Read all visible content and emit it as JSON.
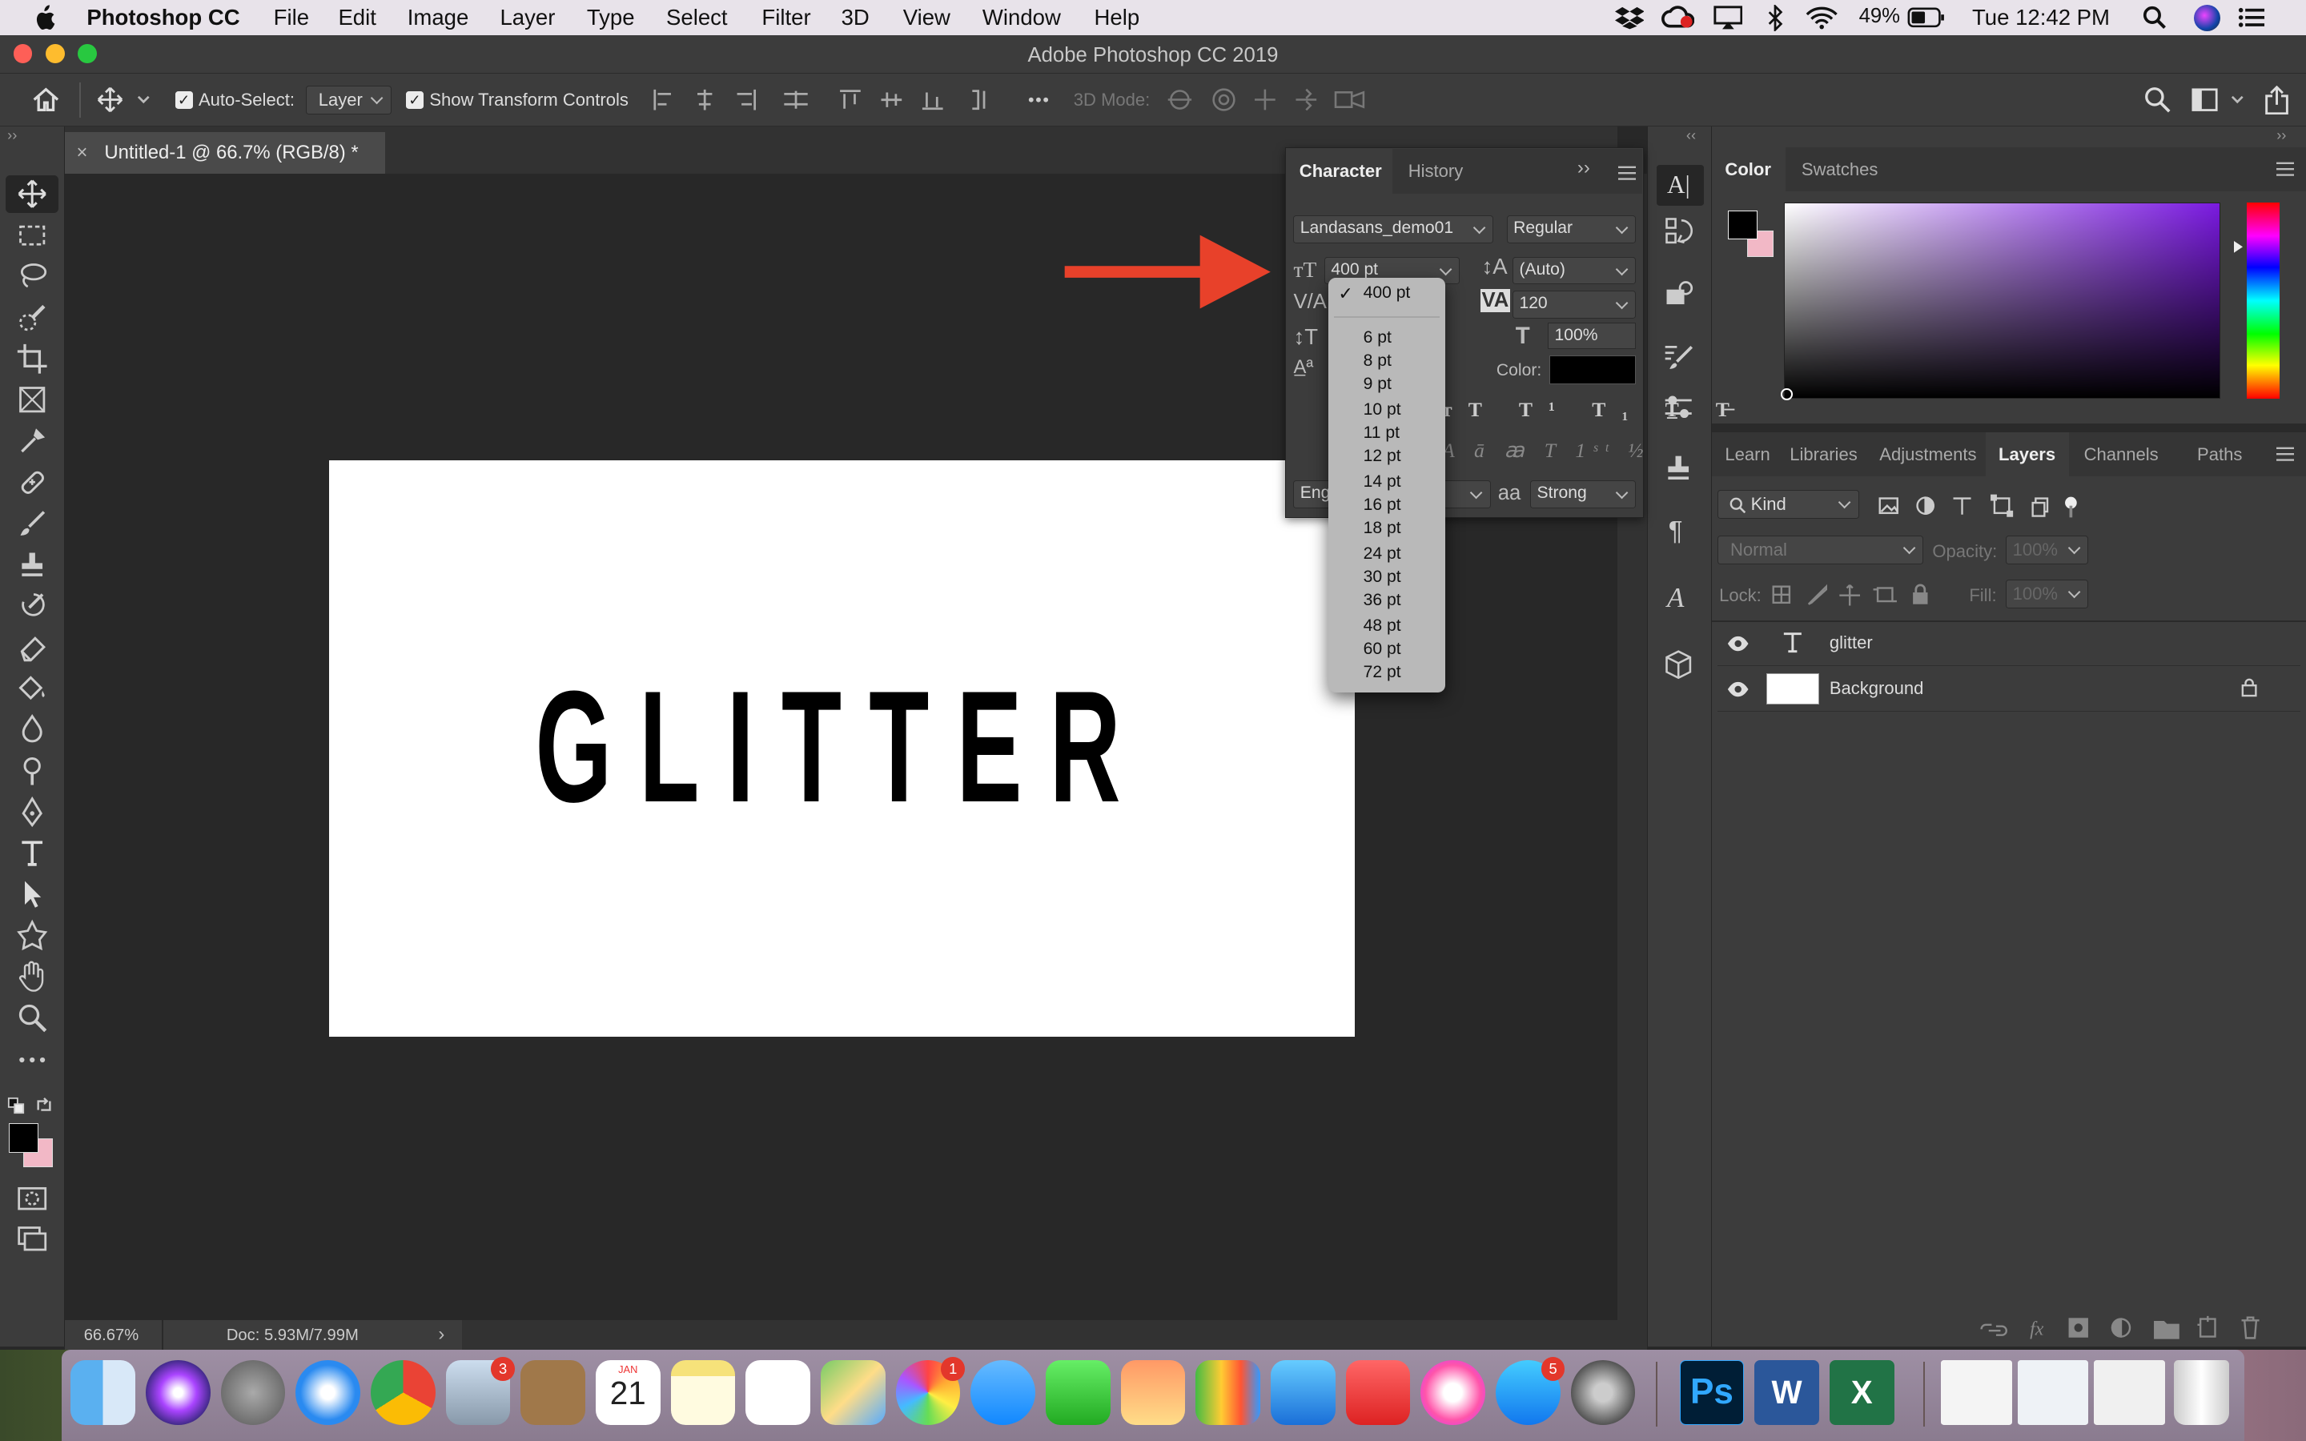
{
  "menubar": {
    "app": "Photoshop CC",
    "items": [
      "File",
      "Edit",
      "Image",
      "Layer",
      "Type",
      "Select",
      "Filter",
      "3D",
      "View",
      "Window",
      "Help"
    ],
    "battery": "49%",
    "clock": "Tue 12:42 PM"
  },
  "window": {
    "title": "Adobe Photoshop CC 2019"
  },
  "options": {
    "auto_select_label": "Auto-Select:",
    "auto_select_value": "Layer",
    "transform_label": "Show Transform Controls",
    "mode3d_label": "3D Mode:"
  },
  "document": {
    "tab_title": "Untitled-1 @ 66.7% (RGB/8) *",
    "canvas_text": "GLITTER",
    "zoom": "66.67%",
    "doc_size": "Doc: 5.93M/7.99M"
  },
  "character": {
    "tabs": [
      "Character",
      "History"
    ],
    "font_family": "Landasans_demo01",
    "font_style": "Regular",
    "font_size": "400 pt",
    "leading": "(Auto)",
    "tracking": "120",
    "horizontal_scale": "100%",
    "color_label": "Color:",
    "language": "Eng",
    "antialias": "Strong",
    "antialias_icon": "aa"
  },
  "size_dropdown": {
    "selected": "400 pt",
    "options": [
      "6 pt",
      "8 pt",
      "9 pt",
      "10 pt",
      "11 pt",
      "12 pt",
      "14 pt",
      "16 pt",
      "18 pt",
      "24 pt",
      "30 pt",
      "36 pt",
      "48 pt",
      "60 pt",
      "72 pt"
    ]
  },
  "color_panel": {
    "tabs": [
      "Color",
      "Swatches"
    ]
  },
  "layers_panel": {
    "tabs": [
      "Learn",
      "Libraries",
      "Adjustments",
      "Layers",
      "Channels",
      "Paths"
    ],
    "filter_kind": "Kind",
    "blend_mode": "Normal",
    "opacity_label": "Opacity:",
    "opacity_value": "100%",
    "lock_label": "Lock:",
    "fill_label": "Fill:",
    "fill_value": "100%",
    "layers": [
      {
        "name": "glitter",
        "type": "text"
      },
      {
        "name": "Background",
        "type": "pixel",
        "locked": true
      }
    ]
  },
  "dock": {
    "calendar_month": "JAN",
    "calendar_day": "21",
    "badges": {
      "mail": "3",
      "photos": "1",
      "appstore": "5"
    }
  },
  "colors": {
    "accent_arrow": "#e8412a",
    "pink_bg": "#f2b8c6"
  }
}
